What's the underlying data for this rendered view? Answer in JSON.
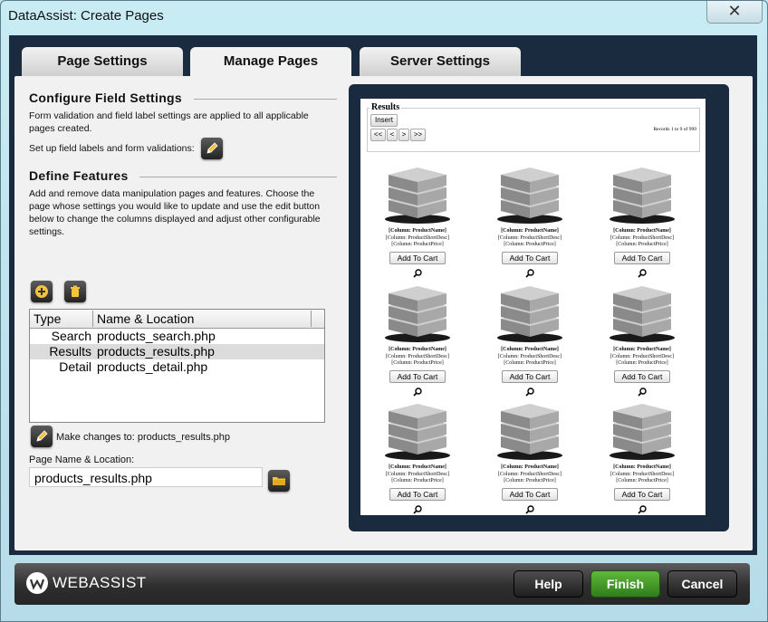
{
  "window": {
    "title": "DataAssist: Create Pages",
    "close_glyph": "✕"
  },
  "tabs": [
    {
      "label": "Page Settings"
    },
    {
      "label": "Manage Pages"
    },
    {
      "label": "Server Settings"
    }
  ],
  "configure": {
    "title": "Configure Field Settings",
    "desc": "Form validation and field label settings are applied to all applicable pages created.",
    "setup_label": "Set up field labels and form validations:"
  },
  "features": {
    "title": "Define Features",
    "desc": "Add and remove data manipulation pages and features. Choose the page whose settings you would like to update and use the edit button below to change the columns displayed and adjust other configurable settings.",
    "columns": {
      "type": "Type",
      "name": "Name & Location"
    },
    "rows": [
      {
        "type": "Search",
        "name": "products_search.php"
      },
      {
        "type": "Results",
        "name": "products_results.php"
      },
      {
        "type": "Detail",
        "name": "products_detail.php"
      }
    ],
    "make_changes": "Make changes to: products_results.php",
    "page_name_label": "Page Name & Location:",
    "page_name_value": "products_results.php"
  },
  "preview": {
    "legend": "Results",
    "insert": "Insert",
    "nav": [
      "<<",
      "<",
      ">",
      ">>"
    ],
    "records": "Records 1 to 9 of 999",
    "product": {
      "name": "[Column: ProductName]",
      "desc": "[Column: ProductShortDesc]",
      "price": "[Column: ProductPrice]",
      "button": "Add To Cart"
    }
  },
  "footer": {
    "logo_text": "WEBASSIST",
    "help": "Help",
    "finish": "Finish",
    "cancel": "Cancel"
  }
}
